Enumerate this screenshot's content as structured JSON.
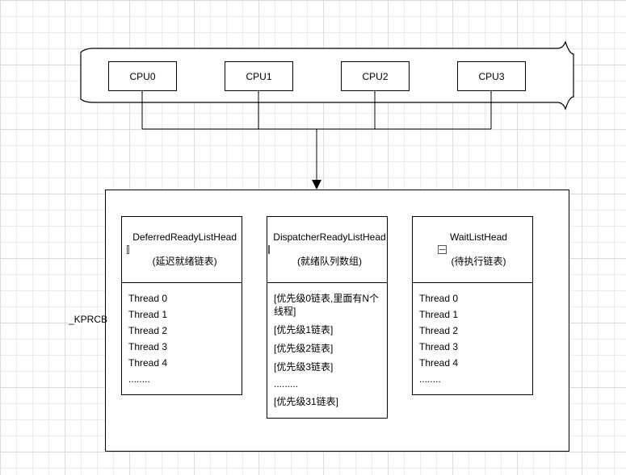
{
  "cpus": {
    "c0": "CPU0",
    "c1": "CPU1",
    "c2": "CPU2",
    "c3": "CPU3"
  },
  "side_label": "_KPRCB",
  "lists": {
    "deferred": {
      "title": "DeferredReadyListHead",
      "subtitle": "(延迟就绪链表)",
      "items": {
        "i0": "Thread 0",
        "i1": "Thread 1",
        "i2": "Thread 2",
        "i3": "Thread 3",
        "i4": "Thread 4",
        "dots": "........"
      }
    },
    "dispatcher": {
      "title": "DispatcherReadyListHead",
      "subtitle": "(就绪队列数组)",
      "items": {
        "i0": "[优先级0链表,里面有N个线程]",
        "i1": "[优先级1链表]",
        "i2": "[优先级2链表]",
        "i3": "[优先级3链表]",
        "dots": ".........",
        "i31": "[优先级31链表]"
      }
    },
    "wait": {
      "title": "WaitListHead",
      "subtitle": "(待执行链表)",
      "items": {
        "i0": "Thread 0",
        "i1": "Thread 1",
        "i2": "Thread 2",
        "i3": "Thread 3",
        "i4": "Thread 4",
        "dots": "........"
      }
    }
  }
}
